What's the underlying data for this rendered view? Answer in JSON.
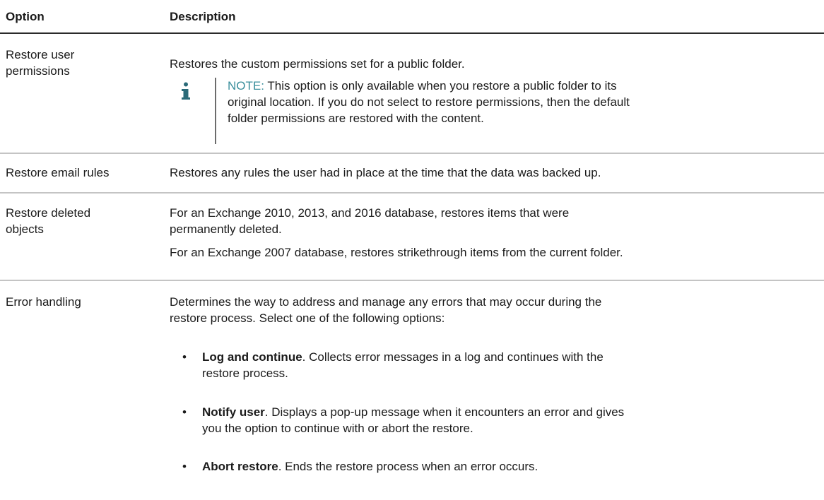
{
  "header": {
    "option": "Option",
    "description": "Description"
  },
  "rows": [
    {
      "option_lines": [
        "Restore user",
        "permissions"
      ],
      "description": "Restores the custom permissions set for a public folder.",
      "note": {
        "label": "NOTE:",
        "lines": [
          " This option is only available when you restore a public folder to its",
          "original location. If you do not select to restore permissions, then the default",
          "folder permissions are restored with the content."
        ]
      }
    },
    {
      "option": "Restore email rules",
      "description": "Restores any rules the user had in place at the time that the data was backed up."
    },
    {
      "option_lines": [
        "Restore deleted",
        "objects"
      ],
      "description_lines": [
        "For an Exchange 2010, 2013, and 2016 database, restores items that were",
        "permanently deleted."
      ],
      "description2": "For an Exchange 2007 database, restores strikethrough items from the current folder."
    },
    {
      "option": "Error handling",
      "description_lines": [
        "Determines the way to address and manage any errors that may occur during the",
        "restore process. Select one of the following options:"
      ],
      "bullets": [
        {
          "title": "Log and continue",
          "lines": [
            ". Collects error messages in a log and continues with the",
            "restore process."
          ]
        },
        {
          "title": "Notify user",
          "lines": [
            ". Displays a pop-up message when it encounters an error and gives",
            "you the option to continue with or abort the restore."
          ]
        },
        {
          "title": "Abort restore",
          "lines": [
            ". Ends the restore process when an error occurs."
          ]
        }
      ]
    }
  ],
  "bullet_symbol": "•",
  "icons": {
    "note": "info-icon"
  },
  "colors": {
    "note_label": "#3b8f9c",
    "header_rule": "#2b2b2b",
    "row_rule": "#c4c4c4"
  }
}
